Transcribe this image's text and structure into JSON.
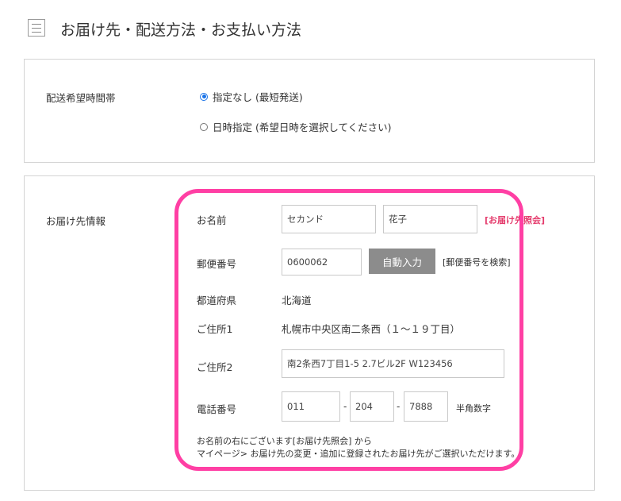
{
  "header": {
    "title": "お届け先・配送方法・お支払い方法",
    "icon": "list-icon"
  },
  "delivery_time": {
    "label": "配送希望時間帯",
    "options": [
      {
        "label": "指定なし (最短発送)",
        "selected": true
      },
      {
        "label": "日時指定 (希望日時を選択してください)",
        "selected": false
      }
    ]
  },
  "recipient": {
    "section_label": "お届け先情報",
    "name": {
      "label": "お名前",
      "last": "セカンド",
      "first": "花子",
      "lookup_link": "[お届け先照会]"
    },
    "postal": {
      "label": "郵便番号",
      "value": "0600062",
      "auto_button": "自動入力",
      "search_link": "[郵便番号を検索]"
    },
    "prefecture": {
      "label": "都道府県",
      "value": "北海道"
    },
    "address1": {
      "label": "ご住所1",
      "value": "札幌市中央区南二条西（１～１９丁目）"
    },
    "address2": {
      "label": "ご住所2",
      "value": "南2条西7丁目1-5 2.7ビル2F W123456"
    },
    "phone": {
      "label": "電話番号",
      "part1": "011",
      "part2": "204",
      "part3": "7888",
      "hint": "半角数字",
      "separator": "-"
    },
    "note_lines": [
      "お名前の右にございます[お届け先照会] から",
      "マイページ> お届け先の変更・追加に登録されたお届け先がご選択いただけます。"
    ]
  },
  "colors": {
    "highlight": "#ff3fa4",
    "link": "#e43a6b",
    "radio_selected": "#1a73e8",
    "button": "#8c8c8c"
  }
}
